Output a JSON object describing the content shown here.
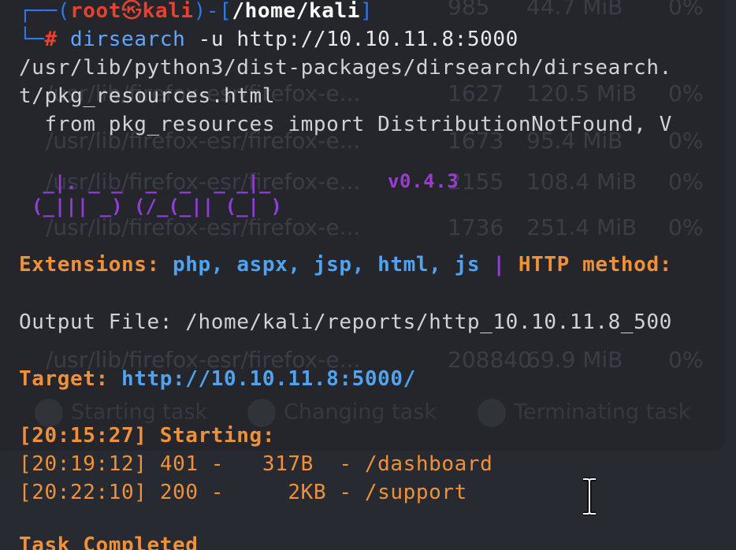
{
  "prompt": {
    "corner_top": "┌──(",
    "user": "root",
    "skull": "㉿",
    "host": "kali",
    "mid": ")-[",
    "path": "/home/kali",
    "close": "]",
    "corner_bottom": "└─",
    "hash": "#",
    "command": "dirsearch",
    "args": "-u http://10.10.11.8:5000"
  },
  "warning": {
    "line1": "/usr/lib/python3/dist-packages/dirsearch/dirsearch.",
    "line2": "t/pkg_resources.html",
    "line3": "  from pkg_resources import DistributionNotFound, V"
  },
  "banner": {
    "art_line1": " _|. _ _  _  _  _ _|_    ",
    "art_line2": "(_||| _) (/_(_|| (_| )",
    "version": "v0.4.3"
  },
  "extensions": {
    "label": "Extensions: ",
    "values": "php, aspx, jsp, html, js",
    "separator": " | ",
    "method_label": "HTTP method:"
  },
  "output": {
    "text": "Output File: /home/kali/reports/http_10.10.11.8_500"
  },
  "target": {
    "label": "Target: ",
    "url": "http://10.10.11.8:5000/"
  },
  "scan": {
    "starting": "[20:15:27] Starting:",
    "results": [
      {
        "time": "[20:19:12]",
        "status": "401",
        "size": "317B",
        "path": "/dashboard"
      },
      {
        "time": "[20:22:10]",
        "status": "200",
        "size": "2KB",
        "path": "/support"
      }
    ],
    "completed": "Task Completed"
  },
  "background_window": {
    "rows": [
      {
        "name": "",
        "pid": "985",
        "mem": "44.7 MiB",
        "cpu": "0%"
      },
      {
        "name": "/usr/lib/firefox-esr/firefox-e...",
        "pid": "1627",
        "mem": "120.5 MiB",
        "cpu": "0%"
      },
      {
        "name": "/usr/lib/firefox-esr/firefox-e...",
        "pid": "1673",
        "mem": "95.4 MiB",
        "cpu": "0%"
      },
      {
        "name": "/usr/lib/firefox-esr/firefox-e...",
        "pid": "2155",
        "mem": "108.4 MiB",
        "cpu": "0%"
      },
      {
        "name": "/usr/lib/firefox-esr/firefox-e...",
        "pid": "1736",
        "mem": "251.4 MiB",
        "cpu": "0%"
      },
      {
        "name": "/usr/lib/firefox-esr/firefox-e...",
        "pid": "208840",
        "mem": "69.9 MiB",
        "cpu": "0%"
      }
    ],
    "buttons": [
      "Starting task",
      "Changing task",
      "Terminating task"
    ]
  }
}
